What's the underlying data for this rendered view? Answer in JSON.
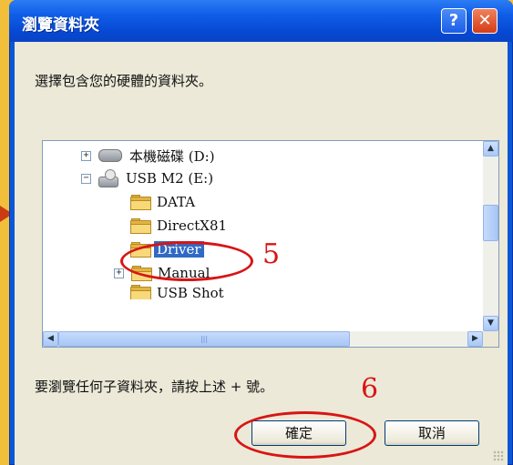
{
  "dialog": {
    "title": "瀏覽資料夾",
    "help_label": "?",
    "close_label": "✕",
    "prompt": "選擇包含您的硬體的資料夾。",
    "hint": "要瀏覽任何子資料夾，請按上述 + 號。",
    "ok_label": "確定",
    "cancel_label": "取消"
  },
  "tree": {
    "items": [
      {
        "label": "本機磁碟 (D:)",
        "expander": "+",
        "icon": "drive-icon"
      },
      {
        "label": "USB M2 (E:)",
        "expander": "−",
        "icon": "usb-drive-icon"
      },
      {
        "label": "DATA",
        "icon": "folder-icon"
      },
      {
        "label": "DirectX81",
        "icon": "folder-icon"
      },
      {
        "label": "Driver",
        "icon": "folder-open-icon",
        "selected": true
      },
      {
        "label": "Manual",
        "expander": "+",
        "icon": "folder-icon"
      },
      {
        "label": "USB Shot",
        "icon": "folder-icon"
      }
    ]
  },
  "annotations": {
    "step5": "5",
    "step6": "6"
  },
  "colors": {
    "titlebar": "#0b57d6",
    "annotation": "#d81515",
    "background": "#f2bf3a",
    "selection": "#316ac5"
  }
}
